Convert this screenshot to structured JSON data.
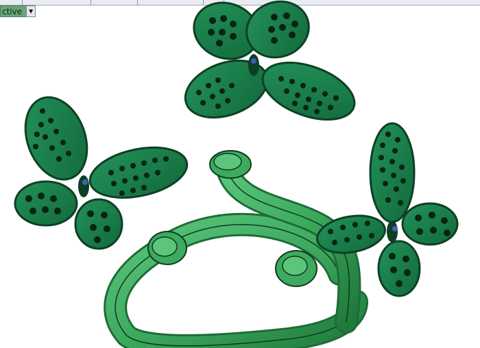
{
  "toolbar": {
    "view_mode": "ctive",
    "dropdown_icon": "chevron-down-icon"
  },
  "colors": {
    "ring": "#3daa5f",
    "ring_dark": "#1f6b36",
    "butterfly": "#1a7a45",
    "butterfly_dark": "#0d3f24",
    "hole": "#062514"
  }
}
